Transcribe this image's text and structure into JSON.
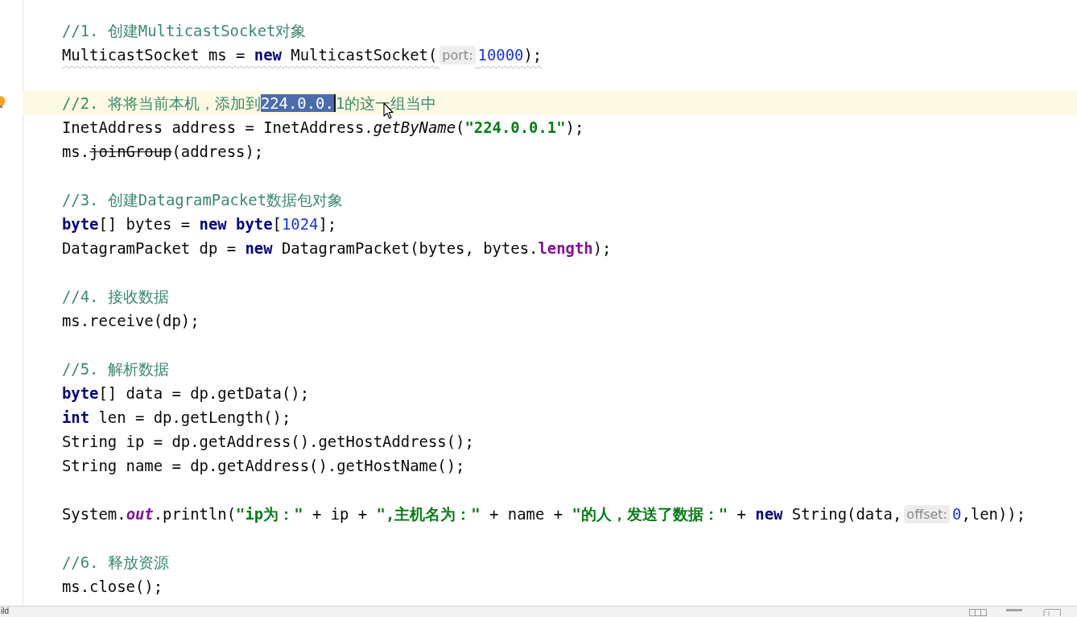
{
  "editor": {
    "blocks": [
      {
        "lines": [
          {
            "current": false,
            "warning": false,
            "tokens": [
              {
                "kind": "comment",
                "text": "//1. 创建MulticastSocket对象"
              }
            ]
          },
          {
            "current": false,
            "warning": true,
            "tokens": [
              {
                "kind": "plain",
                "text": "MulticastSocket ms = "
              },
              {
                "kind": "keyword",
                "text": "new"
              },
              {
                "kind": "plain",
                "text": " MulticastSocket("
              },
              {
                "kind": "hint",
                "text": "port:"
              },
              {
                "kind": "number",
                "text": "10000"
              },
              {
                "kind": "plain",
                "text": ");"
              }
            ]
          }
        ]
      },
      {
        "lines": [
          {
            "current": true,
            "warning": false,
            "tokens": [
              {
                "kind": "comment",
                "text": "//2. 将将当前本机，添加到"
              },
              {
                "kind": "selection",
                "text": "224.0.0."
              },
              {
                "kind": "comment",
                "text": "1的这一组当中"
              }
            ]
          },
          {
            "current": false,
            "warning": false,
            "tokens": [
              {
                "kind": "plain",
                "text": "InetAddress address = InetAddress."
              },
              {
                "kind": "static",
                "text": "getByName"
              },
              {
                "kind": "plain",
                "text": "("
              },
              {
                "kind": "string",
                "text": "\"224.0.0.1\""
              },
              {
                "kind": "plain",
                "text": ");"
              }
            ]
          },
          {
            "current": false,
            "warning": false,
            "tokens": [
              {
                "kind": "plain",
                "text": "ms."
              },
              {
                "kind": "deprecated",
                "text": "joinGroup"
              },
              {
                "kind": "plain",
                "text": "(address);"
              }
            ]
          }
        ]
      },
      {
        "lines": [
          {
            "current": false,
            "warning": false,
            "tokens": [
              {
                "kind": "comment",
                "text": "//3. 创建DatagramPacket数据包对象"
              }
            ]
          },
          {
            "current": false,
            "warning": false,
            "tokens": [
              {
                "kind": "keyword",
                "text": "byte"
              },
              {
                "kind": "plain",
                "text": "[] bytes = "
              },
              {
                "kind": "keyword",
                "text": "new byte"
              },
              {
                "kind": "plain",
                "text": "["
              },
              {
                "kind": "number",
                "text": "1024"
              },
              {
                "kind": "plain",
                "text": "];"
              }
            ]
          },
          {
            "current": false,
            "warning": false,
            "tokens": [
              {
                "kind": "plain",
                "text": "DatagramPacket dp = "
              },
              {
                "kind": "keyword",
                "text": "new"
              },
              {
                "kind": "plain",
                "text": " DatagramPacket(bytes, bytes."
              },
              {
                "kind": "field",
                "text": "length"
              },
              {
                "kind": "plain",
                "text": ");"
              }
            ]
          }
        ]
      },
      {
        "lines": [
          {
            "current": false,
            "warning": false,
            "tokens": [
              {
                "kind": "comment",
                "text": "//4. 接收数据"
              }
            ]
          },
          {
            "current": false,
            "warning": false,
            "tokens": [
              {
                "kind": "plain",
                "text": "ms.receive(dp);"
              }
            ]
          }
        ]
      },
      {
        "lines": [
          {
            "current": false,
            "warning": false,
            "tokens": [
              {
                "kind": "comment",
                "text": "//5. 解析数据"
              }
            ]
          },
          {
            "current": false,
            "warning": false,
            "tokens": [
              {
                "kind": "keyword",
                "text": "byte"
              },
              {
                "kind": "plain",
                "text": "[] data = dp.getData();"
              }
            ]
          },
          {
            "current": false,
            "warning": false,
            "tokens": [
              {
                "kind": "keyword",
                "text": "int"
              },
              {
                "kind": "plain",
                "text": " len = dp.getLength();"
              }
            ]
          },
          {
            "current": false,
            "warning": false,
            "tokens": [
              {
                "kind": "plain",
                "text": "String ip = dp.getAddress().getHostAddress();"
              }
            ]
          },
          {
            "current": false,
            "warning": false,
            "tokens": [
              {
                "kind": "plain",
                "text": "String name = dp.getAddress().getHostName();"
              }
            ]
          }
        ]
      },
      {
        "lines": [
          {
            "current": false,
            "warning": false,
            "tokens": [
              {
                "kind": "plain",
                "text": "System."
              },
              {
                "kind": "staticfield",
                "text": "out"
              },
              {
                "kind": "plain",
                "text": ".println("
              },
              {
                "kind": "string",
                "text": "\"ip为：\""
              },
              {
                "kind": "plain",
                "text": " + ip + "
              },
              {
                "kind": "string",
                "text": "\",主机名为：\""
              },
              {
                "kind": "plain",
                "text": " + name + "
              },
              {
                "kind": "string",
                "text": "\"的人，发送了数据：\""
              },
              {
                "kind": "plain",
                "text": " + "
              },
              {
                "kind": "keyword",
                "text": "new"
              },
              {
                "kind": "plain",
                "text": " String(data,"
              },
              {
                "kind": "hint",
                "text": "offset:"
              },
              {
                "kind": "number",
                "text": "0"
              },
              {
                "kind": "plain",
                "text": ",len));"
              }
            ]
          }
        ]
      },
      {
        "lines": [
          {
            "current": false,
            "warning": false,
            "tokens": [
              {
                "kind": "comment",
                "text": "//6. 释放资源"
              }
            ]
          },
          {
            "current": false,
            "warning": false,
            "tokens": [
              {
                "kind": "plain",
                "text": "ms.close();"
              }
            ]
          }
        ]
      }
    ]
  },
  "status_bar": {
    "text": "ild"
  }
}
